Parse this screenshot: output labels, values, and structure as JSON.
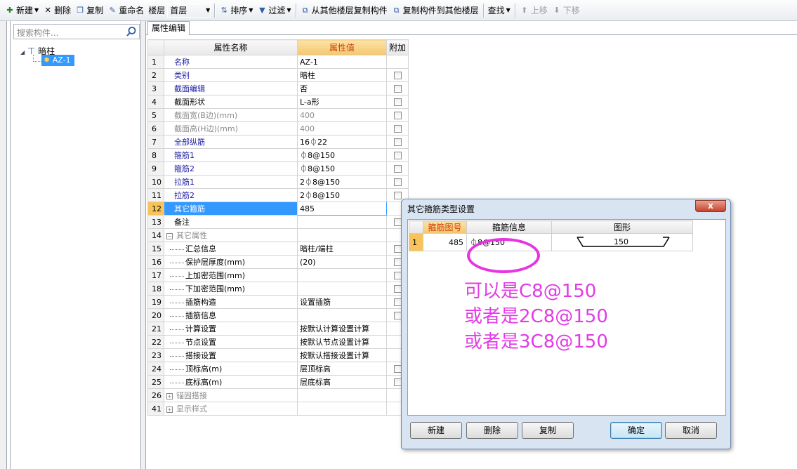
{
  "toolbar": {
    "new": "新建",
    "delete": "删除",
    "copy": "复制",
    "rename": "重命名",
    "floor_label": "楼层",
    "floor_value": "首层",
    "sort": "排序",
    "filter": "过滤",
    "copy_from_floor": "从其他楼层复制构件",
    "copy_to_floor": "复制构件到其他楼层",
    "find": "查找",
    "move_up": "上移",
    "move_down": "下移"
  },
  "tree": {
    "search_placeholder": "搜索构件...",
    "root": "暗柱",
    "child": "AZ-1"
  },
  "editor": {
    "tab": "属性编辑",
    "headers": [
      "属性名称",
      "属性值",
      "附加"
    ],
    "rows": [
      {
        "no": "1",
        "name": "名称",
        "value": "AZ-1"
      },
      {
        "no": "2",
        "name": "类别",
        "value": "暗柱"
      },
      {
        "no": "3",
        "name": "截面编辑",
        "value": "否"
      },
      {
        "no": "4",
        "name": "截面形状",
        "value": "L-a形"
      },
      {
        "no": "5",
        "name": "截面宽(B边)(mm)",
        "value": "400"
      },
      {
        "no": "6",
        "name": "截面高(H边)(mm)",
        "value": "400"
      },
      {
        "no": "7",
        "name": "全部纵筋",
        "value": "16⏀22"
      },
      {
        "no": "8",
        "name": "箍筋1",
        "value": "⏀8@150"
      },
      {
        "no": "9",
        "name": "箍筋2",
        "value": "⏀8@150"
      },
      {
        "no": "10",
        "name": "拉筋1",
        "value": "2⏀8@150"
      },
      {
        "no": "11",
        "name": "拉筋2",
        "value": "2⏀8@150"
      },
      {
        "no": "12",
        "name": "其它箍筋",
        "value": "485"
      },
      {
        "no": "13",
        "name": "备注",
        "value": ""
      },
      {
        "no": "14",
        "name": "其它属性",
        "value": ""
      },
      {
        "no": "15",
        "name": "汇总信息",
        "value": "暗柱/端柱"
      },
      {
        "no": "16",
        "name": "保护层厚度(mm)",
        "value": "(20)"
      },
      {
        "no": "17",
        "name": "上加密范围(mm)",
        "value": ""
      },
      {
        "no": "18",
        "name": "下加密范围(mm)",
        "value": ""
      },
      {
        "no": "19",
        "name": "插筋构造",
        "value": "设置插筋"
      },
      {
        "no": "20",
        "name": "插筋信息",
        "value": ""
      },
      {
        "no": "21",
        "name": "计算设置",
        "value": "按默认计算设置计算"
      },
      {
        "no": "22",
        "name": "节点设置",
        "value": "按默认节点设置计算"
      },
      {
        "no": "23",
        "name": "搭接设置",
        "value": "按默认搭接设置计算"
      },
      {
        "no": "24",
        "name": "顶标高(m)",
        "value": "层顶标高"
      },
      {
        "no": "25",
        "name": "底标高(m)",
        "value": "层底标高"
      },
      {
        "no": "26",
        "name": "锚固搭接",
        "value": ""
      },
      {
        "no": "41",
        "name": "显示样式",
        "value": ""
      }
    ]
  },
  "dialog": {
    "title": "其它箍筋类型设置",
    "close": "x",
    "headers": [
      "箍筋图号",
      "箍筋信息",
      "图形"
    ],
    "row": {
      "no": "1",
      "code": "485",
      "info": "⏀8@150",
      "shape_dim": "150"
    },
    "annotation": [
      "可以是C8@150",
      "或者是2C8@150",
      "或者是3C8@150"
    ],
    "buttons": {
      "new": "新建",
      "delete": "删除",
      "copy": "复制",
      "ok": "确定",
      "cancel": "取消"
    }
  },
  "colors": {
    "annotation": "#e23be6",
    "selection": "#3399ff",
    "header_highlight": "#f4c76f"
  }
}
